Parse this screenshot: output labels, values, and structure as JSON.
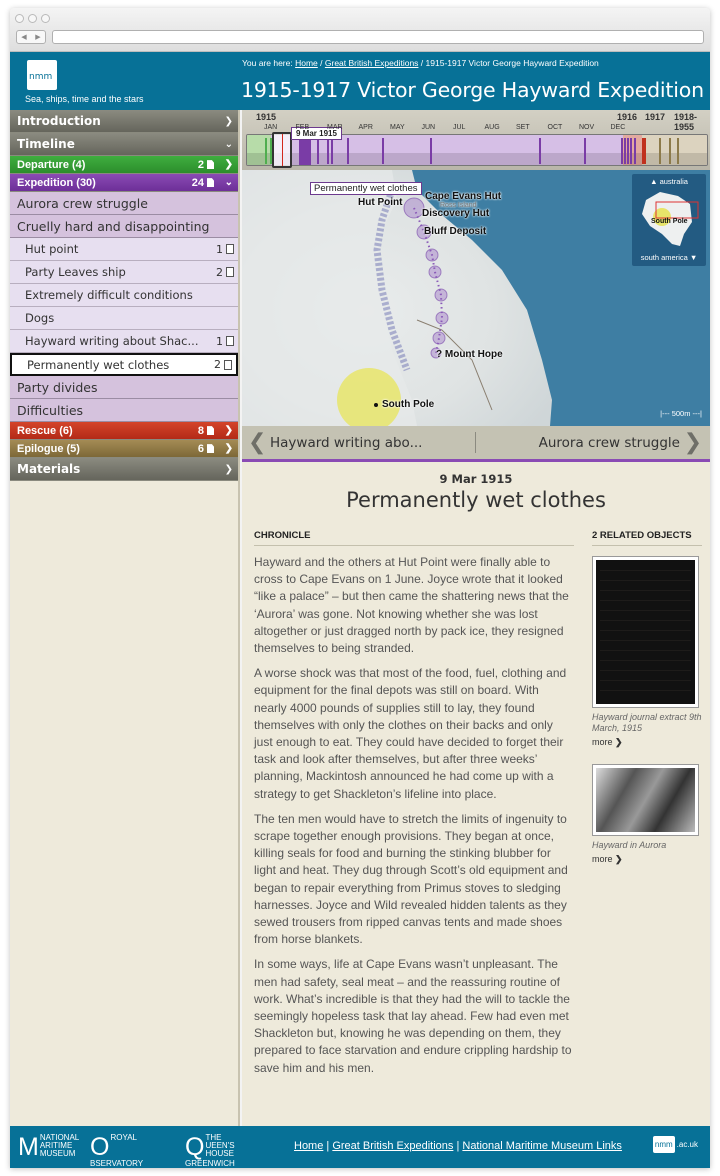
{
  "browser": {
    "url": ""
  },
  "header": {
    "logo_text": "nmm",
    "tagline": "Sea, ships, time and the stars",
    "breadcrumb_prefix": "You are here:",
    "breadcrumb": [
      {
        "label": "Home",
        "link": true
      },
      {
        "label": "Great British Expeditions",
        "link": true
      },
      {
        "label": "1915-1917  Victor George Hayward Expedition",
        "link": false
      }
    ],
    "title": "1915-1917  Victor George Hayward Expedition"
  },
  "sidebar": {
    "items": [
      {
        "label": "Introduction",
        "style": "grey",
        "chevron": "right"
      },
      {
        "label": "Timeline",
        "style": "grey",
        "chevron": "down"
      },
      {
        "label": "Departure (4)",
        "style": "green",
        "count": "2",
        "chevron": "right"
      },
      {
        "label": "Expedition (30)",
        "style": "purple",
        "count": "24",
        "chevron": "down"
      },
      {
        "label": "Aurora crew struggle",
        "style": "sub"
      },
      {
        "label": "Cruelly hard and disappointing",
        "style": "sub"
      },
      {
        "label": "Hut point",
        "style": "leaf",
        "count": "1"
      },
      {
        "label": "Party Leaves ship",
        "style": "leaf",
        "count": "2"
      },
      {
        "label": "Extremely difficult conditions",
        "style": "leaf"
      },
      {
        "label": "Dogs",
        "style": "leaf"
      },
      {
        "label": "Hayward writing about Shac...",
        "style": "leaf",
        "count": "1"
      },
      {
        "label": "Permanently wet clothes",
        "style": "leaf",
        "count": "2",
        "active": true
      },
      {
        "label": "Party divides",
        "style": "sub"
      },
      {
        "label": "Difficulties",
        "style": "sub"
      },
      {
        "label": "Rescue (6)",
        "style": "red",
        "count": "8",
        "chevron": "right"
      },
      {
        "label": "Epilogue (5)",
        "style": "olive",
        "count": "6",
        "chevron": "right"
      },
      {
        "label": "Materials",
        "style": "grey",
        "chevron": "right"
      }
    ]
  },
  "timeline": {
    "year_start": "1915",
    "months": [
      "JAN",
      "FEB",
      "MAR",
      "APR",
      "MAY",
      "JUN",
      "JUL",
      "AUG",
      "SET",
      "OCT",
      "NOV",
      "DEC"
    ],
    "years_end": [
      "1916",
      "1917",
      "1918-1955"
    ],
    "selected_date": "9 Mar 1915",
    "colors": {
      "departure": "#4fae4f",
      "expedition": "#7a3ca6",
      "rescue": "#c0301e",
      "epilogue": "#8c7a4a"
    }
  },
  "map": {
    "callout": "Permanently wet clothes",
    "places": [
      "Hut Point",
      "Cape Evans Hut",
      "Ross Island",
      "Discovery Hut",
      "Bluff Deposit",
      "? Mount Hope",
      "South Pole"
    ],
    "inset_up": "australia",
    "inset_down": "south america",
    "inset_label": "South Pole",
    "scale": "500m"
  },
  "pager": {
    "prev": "Hayward writing abo...",
    "next": "Aurora crew struggle"
  },
  "entry": {
    "date": "9 Mar 1915",
    "title": "Permanently wet clothes",
    "section": "CHRONICLE",
    "paragraphs": [
      "Hayward and the others at Hut Point were finally able to cross to Cape Evans on 1 June. Joyce wrote that it looked “like a palace” – but then came the shattering news that the ‘Aurora’ was gone. Not knowing whether she was lost altogether or just dragged north by pack ice, they resigned themselves to being stranded.",
      "A worse shock was that most of the food, fuel, clothing and equipment for the final depots was still on board. With nearly 4000 pounds of supplies still to lay, they found themselves with only the clothes on their backs and only just enough to eat. They could have decided to forget their task and look after themselves, but after three weeks’ planning, Mackintosh announced he had come up with a strategy to get Shackleton’s lifeline into place.",
      "The ten men would have to stretch the limits of ingenuity to scrape together enough provisions. They began at once, killing seals for food and burning the stinking blubber for light and heat. They dug through Scott’s old equipment and began to repair everything from Primus stoves to sledging harnesses. Joyce and Wild revealed hidden talents as they sewed trousers from ripped canvas tents and made shoes from horse blankets.",
      "In some ways, life at Cape Evans wasn’t unpleasant. The men had safety, seal meat – and the reassuring routine of work. What’s incredible is that they had the will to tackle the seemingly hopeless task that lay ahead. Few had even met Shackleton but, knowing he was depending on them, they prepared to face starvation and endure crippling hardship to save him and his men."
    ]
  },
  "related": {
    "heading": "2 RELATED OBJECTS",
    "objects": [
      {
        "caption": "Hayward journal extract 9th March, 1915",
        "more": "more"
      },
      {
        "caption": "Hayward in Aurora",
        "more": "more"
      }
    ]
  },
  "footer": {
    "logos": [
      "National Maritime Museum",
      "Royal Observatory Greenwich",
      "The Queen's House Greenwich"
    ],
    "links": [
      "Home",
      "Great British Expeditions",
      "National Maritime Museum Links"
    ],
    "site": ".ac.uk",
    "site_logo": "nmm"
  }
}
